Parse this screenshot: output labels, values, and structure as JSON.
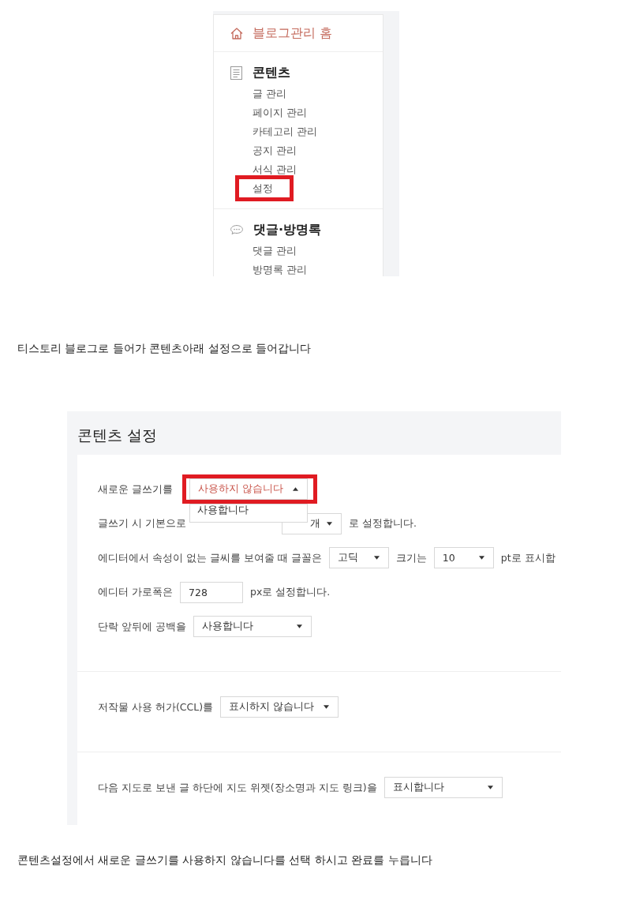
{
  "sidebar_screenshot": {
    "home": {
      "label": "블로그관리 홈"
    },
    "sections": [
      {
        "title": "콘텐츠",
        "items": [
          {
            "label": "글 관리",
            "highlighted": false
          },
          {
            "label": "페이지 관리",
            "highlighted": false
          },
          {
            "label": "카테고리 관리",
            "highlighted": false
          },
          {
            "label": "공지 관리",
            "highlighted": false
          },
          {
            "label": "서식 관리",
            "highlighted": false
          },
          {
            "label": "설정",
            "highlighted": true
          }
        ]
      },
      {
        "title": "댓글·방명록",
        "items": [
          {
            "label": "댓글 관리",
            "highlighted": false
          },
          {
            "label": "방명록 관리",
            "highlighted": false
          }
        ]
      }
    ]
  },
  "caption_1": "티스토리 블로그로 들어가 콘텐츠아래 설정으로 들어갑니다",
  "settings_screenshot": {
    "title": "콘텐츠 설정",
    "groups": [
      {
        "rows": [
          {
            "parts": [
              {
                "kind": "text",
                "text": "새로운 글쓰기를"
              },
              {
                "kind": "select",
                "value": "사용하지 않습니다",
                "expanded": true,
                "highlighted": true,
                "options": [
                  "사용합니다"
                ]
              }
            ]
          },
          {
            "parts": [
              {
                "kind": "text",
                "text": "글쓰기 시 기본으로"
              },
              {
                "kind": "select",
                "value": "개",
                "expanded": false,
                "highlighted": false
              },
              {
                "kind": "text",
                "text": "로 설정합니다."
              }
            ]
          },
          {
            "parts": [
              {
                "kind": "text",
                "text": "에디터에서 속성이 없는 글씨를 보여줄 때 글꼴은"
              },
              {
                "kind": "select",
                "value": "고딕",
                "expanded": false,
                "highlighted": false
              },
              {
                "kind": "text",
                "text": "크기는"
              },
              {
                "kind": "select",
                "value": "10",
                "expanded": false,
                "highlighted": false
              },
              {
                "kind": "text",
                "text": "pt로 표시합"
              }
            ]
          },
          {
            "parts": [
              {
                "kind": "text",
                "text": "에디터 가로폭은"
              },
              {
                "kind": "input",
                "value": "728"
              },
              {
                "kind": "text",
                "text": "px로 설정합니다."
              }
            ]
          },
          {
            "parts": [
              {
                "kind": "text",
                "text": "단락 앞뒤에 공백을"
              },
              {
                "kind": "select",
                "value": "사용합니다",
                "expanded": false,
                "highlighted": false
              }
            ]
          }
        ]
      },
      {
        "rows": [
          {
            "parts": [
              {
                "kind": "text",
                "text": "저작물 사용 허가(CCL)를"
              },
              {
                "kind": "select",
                "value": "표시하지 않습니다",
                "expanded": false,
                "highlighted": false
              }
            ]
          }
        ]
      },
      {
        "rows": [
          {
            "parts": [
              {
                "kind": "text",
                "text": "다음 지도로 보낸 글 하단에 지도 위젯(장소명과 지도 링크)을"
              },
              {
                "kind": "select",
                "value": "표시합니다",
                "expanded": false,
                "highlighted": false
              }
            ]
          }
        ]
      }
    ]
  },
  "caption_2": "콘텐츠설정에서 새로운 글쓰기를 사용하지 않습니다를 선택 하시고 완료를 누릅니다"
}
